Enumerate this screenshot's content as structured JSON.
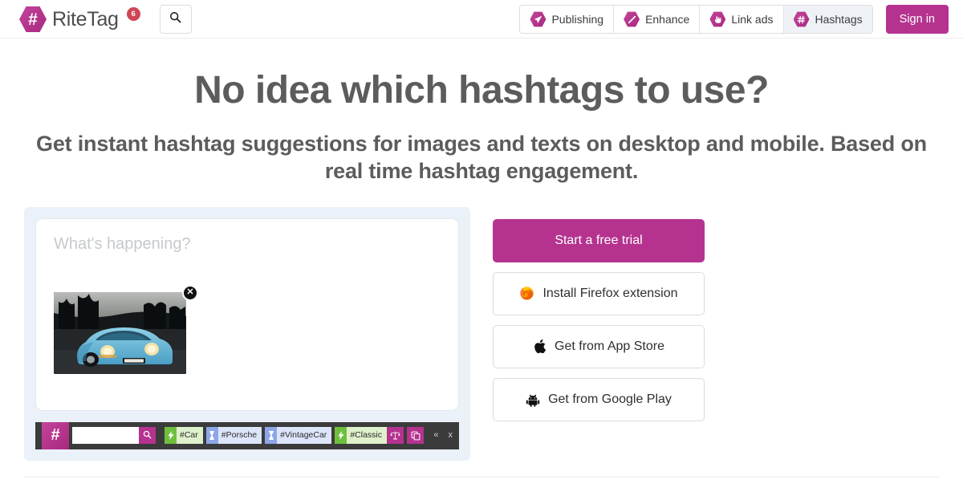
{
  "header": {
    "brand_name": "RiteTag",
    "brand_icon": "hashtag-hexagon-icon",
    "notification_count": "6",
    "search_icon": "search-icon",
    "nav_items": [
      {
        "label": "Publishing",
        "icon": "paper-plane-icon",
        "active": false
      },
      {
        "label": "Enhance",
        "icon": "magic-wand-icon",
        "active": false
      },
      {
        "label": "Link ads",
        "icon": "pointing-hand-icon",
        "active": false
      },
      {
        "label": "Hashtags",
        "icon": "hashtag-icon",
        "active": true
      }
    ],
    "signin_label": "Sign in"
  },
  "hero": {
    "headline": "No idea which hashtags to use?",
    "subheadline": "Get instant hashtag suggestions for images and texts on desktop and mobile. Based on real time hashtag engagement."
  },
  "demo": {
    "compose_placeholder": "What's happening?",
    "compose_value": "",
    "image_alt": "light-blue-classic-porsche-911-on-road",
    "remove_image_icon": "close-icon",
    "toolbar": {
      "logo_icon": "hashtag-hexagon-icon",
      "search_value": "",
      "search_placeholder": "",
      "search_icon": "search-icon",
      "chips": [
        {
          "label": "#Car",
          "type": "hot",
          "badge_icon": "lightning-bolt-icon"
        },
        {
          "label": "#Porsche",
          "type": "long",
          "badge_icon": "hourglass-icon"
        },
        {
          "label": "#VintageCar",
          "type": "long",
          "badge_icon": "hourglass-icon"
        },
        {
          "label": "#Classic",
          "type": "hot",
          "badge_icon": "lightning-bolt-icon"
        }
      ],
      "actions": [
        {
          "icon": "scales-balance-icon"
        },
        {
          "icon": "copy-duplicate-icon"
        }
      ],
      "collapse_label": "«",
      "close_label": "x"
    }
  },
  "ctas": {
    "primary": {
      "label": "Start a free trial"
    },
    "secondary": [
      {
        "label": "Install Firefox extension",
        "icon": "firefox-icon"
      },
      {
        "label": "Get from App Store",
        "icon": "apple-icon"
      },
      {
        "label": "Get from Google Play",
        "icon": "android-icon"
      }
    ]
  },
  "colors": {
    "brand_magenta": "#b5338f",
    "badge_red": "#ce4655",
    "text_grey": "#5c5c5c",
    "panel_bg": "#eaf1f8",
    "toolbar_dark": "#3b3b3b",
    "hot_green": "#6fbf3f",
    "long_blue": "#8ea6e8"
  }
}
